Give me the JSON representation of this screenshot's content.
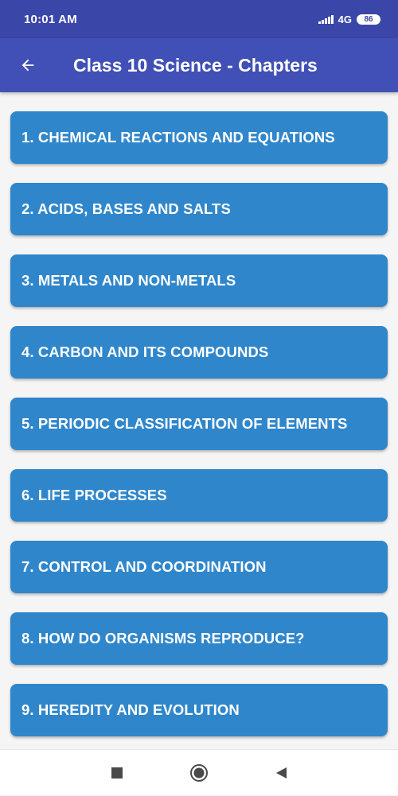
{
  "status_bar": {
    "time": "10:01 AM",
    "network": "4G",
    "battery": "86"
  },
  "app_bar": {
    "back_icon": "arrow-left-icon",
    "title": "Class 10 Science - Chapters"
  },
  "chapters": [
    {
      "label": "1. CHEMICAL REACTIONS AND EQUATIONS"
    },
    {
      "label": "2. ACIDS, BASES AND SALTS"
    },
    {
      "label": "3. METALS AND NON-METALS"
    },
    {
      "label": "4. CARBON AND ITS COMPOUNDS"
    },
    {
      "label": "5. PERIODIC CLASSIFICATION OF ELEMENTS"
    },
    {
      "label": "6. LIFE PROCESSES"
    },
    {
      "label": "7. CONTROL AND COORDINATION"
    },
    {
      "label": "8. HOW DO ORGANISMS REPRODUCE?"
    },
    {
      "label": "9. HEREDITY AND EVOLUTION"
    }
  ],
  "nav_bar": {
    "icons": [
      "recents-square-icon",
      "home-circle-icon",
      "back-triangle-icon"
    ]
  },
  "colors": {
    "status_bar": "#3a46a8",
    "app_bar": "#4150b6",
    "chapter_button": "#2f86cb",
    "background": "#f5f5f5"
  }
}
